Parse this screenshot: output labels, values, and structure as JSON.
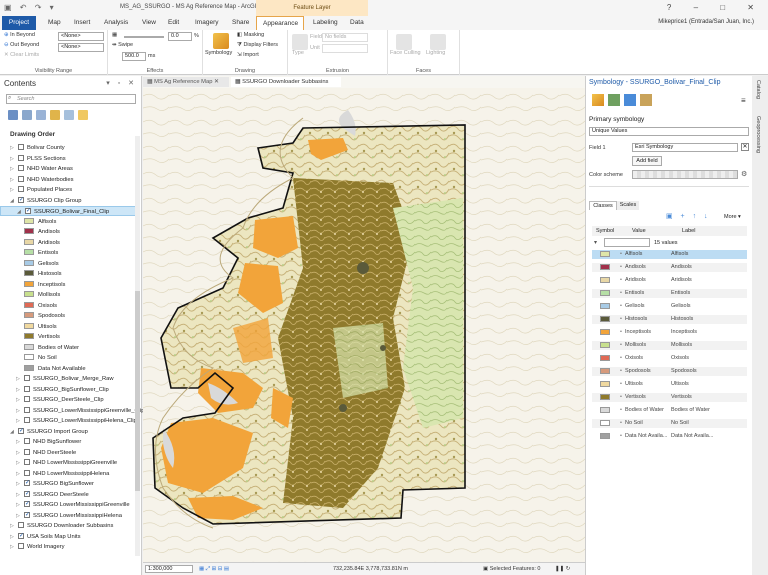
{
  "titlebar": {
    "title": "MS_AG_SSURGO - MS Ag Reference Map - ArcGIS Pro",
    "context_tab": "Feature Layer"
  },
  "tabs": [
    "Project",
    "Map",
    "Insert",
    "Analysis",
    "View",
    "Edit",
    "Imagery",
    "Share",
    "Appearance",
    "Labeling",
    "Data"
  ],
  "active_tab": "Appearance",
  "user": "Mikeprice1 (Entrada/San Juan, Inc.)",
  "ribbon": {
    "visibility": {
      "in_beyond": "In Beyond",
      "out_beyond": "Out Beyond",
      "clear_limits": "Clear Limits",
      "combo1": "<None>",
      "combo2": "<None>",
      "label": "Visibility Range"
    },
    "effects": {
      "transparency": "0.0",
      "transparency_unit": "%",
      "swipe": "Swipe",
      "swipe_value": "500.0",
      "swipe_unit": "ms",
      "label": "Effects"
    },
    "drawing": {
      "symbology": "Symbology",
      "masking": "Masking",
      "display_filters": "Display Filters",
      "import": "Import",
      "label": "Drawing"
    },
    "extrusion": {
      "type": "Type",
      "field": "Field",
      "no_fields": "No fields",
      "unit": "Unit",
      "label": "Extrusion"
    },
    "faces": {
      "face_culling": "Face Culling",
      "lighting": "Lighting",
      "label": "Faces"
    }
  },
  "contents": {
    "title": "Contents",
    "search_placeholder": "Search",
    "drawing_order": "Drawing Order",
    "items": [
      {
        "label": "Bolivar County",
        "checked": false
      },
      {
        "label": "PLSS Sections",
        "checked": false
      },
      {
        "label": "NHD Water Areas",
        "checked": false
      },
      {
        "label": "NHD Waterbodies",
        "checked": false
      },
      {
        "label": "Populated Places",
        "checked": false
      },
      {
        "label": "SSURGO Clip Group",
        "checked": true
      },
      {
        "label": "SSURGO_Bolivar_Final_Clip",
        "checked": true
      },
      {
        "label": "SSURGO_Bolivar_Merge_Raw",
        "checked": false
      },
      {
        "label": "SSURGO_BigSunflower_Clip",
        "checked": false
      },
      {
        "label": "SSURGO_DeerSteele_Clip",
        "checked": false
      },
      {
        "label": "SSURGO_LowerMississippiGreenville_Clip",
        "checked": false
      },
      {
        "label": "SSURGO_LowerMississippiHelena_Clip",
        "checked": false
      },
      {
        "label": "SSURGO Import Group",
        "checked": true
      },
      {
        "label": "NHD BigSunflower",
        "checked": false
      },
      {
        "label": "NHD DeerSteele",
        "checked": false
      },
      {
        "label": "NHD LowerMississippiGreenville",
        "checked": false
      },
      {
        "label": "NHD LowerMississippiHelena",
        "checked": false
      },
      {
        "label": "SSURGO BigSunflower",
        "checked": true
      },
      {
        "label": "SSURGO DeerSteele",
        "checked": true
      },
      {
        "label": "SSURGO LowerMississippiGreenville",
        "checked": true
      },
      {
        "label": "SSURGO LowerMississippiHelena",
        "checked": true
      },
      {
        "label": "SSURGO Downloader Subbasins",
        "checked": false
      },
      {
        "label": "USA Soils Map Units",
        "checked": true
      },
      {
        "label": "World Imagery",
        "checked": false
      }
    ],
    "legend": [
      {
        "label": "Alfisols",
        "color": "#dfe6a8"
      },
      {
        "label": "Andisols",
        "color": "#a0304a"
      },
      {
        "label": "Aridisols",
        "color": "#e8d7a6"
      },
      {
        "label": "Entisols",
        "color": "#b6dfa6"
      },
      {
        "label": "Gelisols",
        "color": "#a8cbe6"
      },
      {
        "label": "Histosols",
        "color": "#5a5a3a"
      },
      {
        "label": "Inceptisols",
        "color": "#f2a43a"
      },
      {
        "label": "Mollisols",
        "color": "#c8e08e"
      },
      {
        "label": "Oxisols",
        "color": "#e06a55"
      },
      {
        "label": "Spodosols",
        "color": "#d69a7c"
      },
      {
        "label": "Ultisols",
        "color": "#f0d9a0"
      },
      {
        "label": "Vertisols",
        "color": "#8f7a2c"
      },
      {
        "label": "Bodies of Water",
        "color": "#d9d9d9"
      },
      {
        "label": "No Soil",
        "color": "#ffffff"
      },
      {
        "label": "Data Not Available",
        "color": "#a0a0a0"
      }
    ]
  },
  "map": {
    "tabs": [
      "MS Ag Reference Map",
      "SSURGO Downloader Subbasins"
    ],
    "scale": "1:300,000",
    "coordinates": "732,235.84E 3,778,733.81N m",
    "selected": "Selected Features: 0"
  },
  "symbology": {
    "title": "Symbology - SSURGO_Bolivar_Final_Clip",
    "primary": "Primary symbology",
    "method": "Unique Values",
    "field_label": "Field 1",
    "field_value": "Esri Symbology",
    "add_field": "Add field",
    "color_scheme": "Color scheme",
    "tabs": [
      "Classes",
      "Scales"
    ],
    "more": "More",
    "columns": [
      "Symbol",
      "Value",
      "Label"
    ],
    "count": "15 values",
    "rows": [
      {
        "value": "Alfisols",
        "label": "Alfisols",
        "color": "#dfe6a8"
      },
      {
        "value": "Andisols",
        "label": "Andisols",
        "color": "#a0304a"
      },
      {
        "value": "Aridisols",
        "label": "Aridisols",
        "color": "#e8d7a6"
      },
      {
        "value": "Entisols",
        "label": "Entisols",
        "color": "#b6dfa6"
      },
      {
        "value": "Gelisols",
        "label": "Gelisols",
        "color": "#a8cbe6"
      },
      {
        "value": "Histosols",
        "label": "Histosols",
        "color": "#5a5a3a"
      },
      {
        "value": "Inceptisols",
        "label": "Inceptisols",
        "color": "#f2a43a"
      },
      {
        "value": "Mollisols",
        "label": "Mollisols",
        "color": "#c8e08e"
      },
      {
        "value": "Oxisols",
        "label": "Oxisols",
        "color": "#e06a55"
      },
      {
        "value": "Spodosols",
        "label": "Spodosols",
        "color": "#d69a7c"
      },
      {
        "value": "Ultisols",
        "label": "Ultisols",
        "color": "#f0d9a0"
      },
      {
        "value": "Vertisols",
        "label": "Vertisols",
        "color": "#8f7a2c"
      },
      {
        "value": "Bodies of Water",
        "label": "Bodies of Water",
        "color": "#d9d9d9"
      },
      {
        "value": "No Soil",
        "label": "No Soil",
        "color": "#ffffff"
      },
      {
        "value": "Data Not Availa...",
        "label": "Data Not Availa...",
        "color": "#a0a0a0"
      }
    ]
  },
  "side_tabs": [
    "Catalog",
    "Geoprocessing"
  ]
}
